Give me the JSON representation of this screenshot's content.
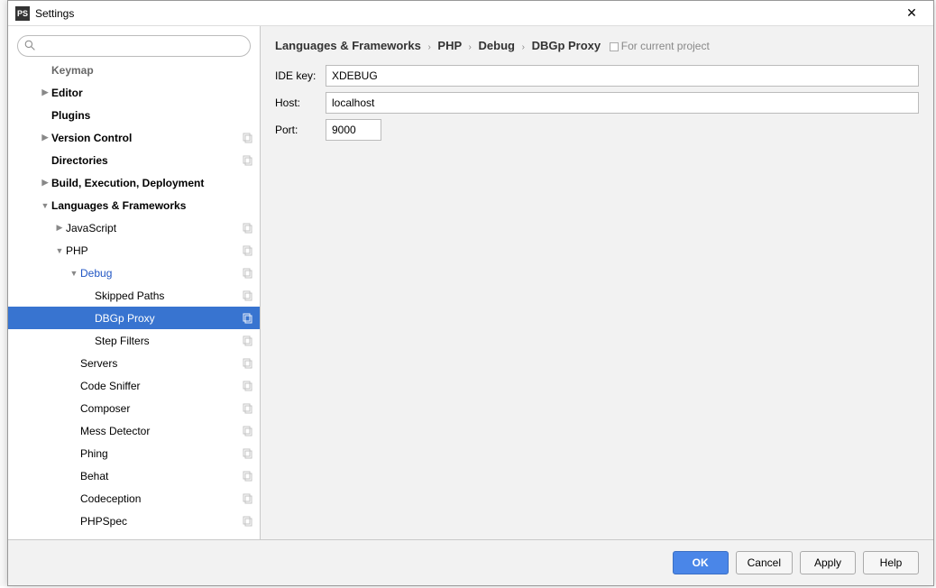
{
  "window": {
    "title": "Settings",
    "app_icon_text": "PS"
  },
  "search": {
    "placeholder": ""
  },
  "tree": {
    "items": [
      {
        "label": "Keymap",
        "bold": true,
        "indent": 1,
        "arrow": "",
        "copy": false,
        "faded": true
      },
      {
        "label": "Editor",
        "bold": true,
        "indent": 1,
        "arrow": "▶",
        "copy": false
      },
      {
        "label": "Plugins",
        "bold": true,
        "indent": 1,
        "arrow": "",
        "copy": false
      },
      {
        "label": "Version Control",
        "bold": true,
        "indent": 1,
        "arrow": "▶",
        "copy": true
      },
      {
        "label": "Directories",
        "bold": true,
        "indent": 1,
        "arrow": "",
        "copy": true
      },
      {
        "label": "Build, Execution, Deployment",
        "bold": true,
        "indent": 1,
        "arrow": "▶",
        "copy": false
      },
      {
        "label": "Languages & Frameworks",
        "bold": true,
        "indent": 1,
        "arrow": "▼",
        "copy": false
      },
      {
        "label": "JavaScript",
        "bold": false,
        "indent": 2,
        "arrow": "▶",
        "copy": true
      },
      {
        "label": "PHP",
        "bold": false,
        "indent": 2,
        "arrow": "▼",
        "copy": true
      },
      {
        "label": "Debug",
        "bold": false,
        "indent": 3,
        "arrow": "▼",
        "copy": true,
        "link": true
      },
      {
        "label": "Skipped Paths",
        "bold": false,
        "indent": 4,
        "arrow": "",
        "copy": true
      },
      {
        "label": "DBGp Proxy",
        "bold": false,
        "indent": 4,
        "arrow": "",
        "copy": true,
        "selected": true
      },
      {
        "label": "Step Filters",
        "bold": false,
        "indent": 4,
        "arrow": "",
        "copy": true
      },
      {
        "label": "Servers",
        "bold": false,
        "indent": 3,
        "arrow": "",
        "copy": true
      },
      {
        "label": "Code Sniffer",
        "bold": false,
        "indent": 3,
        "arrow": "",
        "copy": true
      },
      {
        "label": "Composer",
        "bold": false,
        "indent": 3,
        "arrow": "",
        "copy": true
      },
      {
        "label": "Mess Detector",
        "bold": false,
        "indent": 3,
        "arrow": "",
        "copy": true
      },
      {
        "label": "Phing",
        "bold": false,
        "indent": 3,
        "arrow": "",
        "copy": true
      },
      {
        "label": "Behat",
        "bold": false,
        "indent": 3,
        "arrow": "",
        "copy": true
      },
      {
        "label": "Codeception",
        "bold": false,
        "indent": 3,
        "arrow": "",
        "copy": true
      },
      {
        "label": "PHPSpec",
        "bold": false,
        "indent": 3,
        "arrow": "",
        "copy": true
      }
    ]
  },
  "breadcrumb": {
    "parts": [
      "Languages & Frameworks",
      "PHP",
      "Debug",
      "DBGp Proxy"
    ],
    "suffix": "For current project"
  },
  "form": {
    "ide_key_label": "IDE key:",
    "ide_key_value": "XDEBUG",
    "host_label": "Host:",
    "host_value": "localhost",
    "port_label": "Port:",
    "port_value": "9000"
  },
  "buttons": {
    "ok": "OK",
    "cancel": "Cancel",
    "apply": "Apply",
    "help": "Help"
  }
}
